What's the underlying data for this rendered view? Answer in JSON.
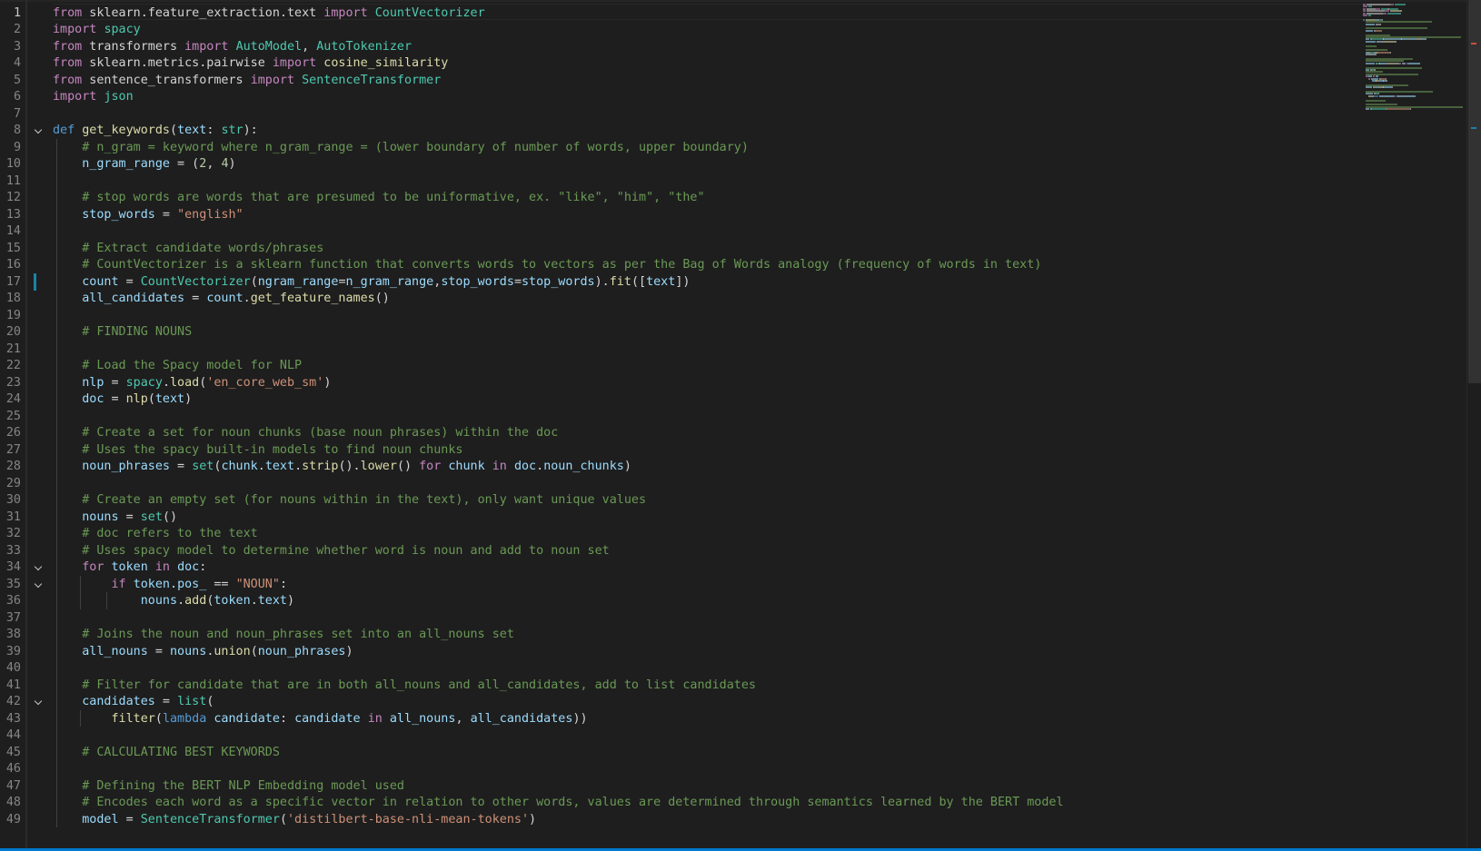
{
  "editor": {
    "language": "python",
    "active_line": 1,
    "theme_colors": {
      "background": "#1e1e1e",
      "keyword": "#569cd6",
      "control_keyword": "#c586c0",
      "comment": "#6a9955",
      "string": "#ce9178",
      "number": "#b5cea8",
      "function": "#dcdcaa",
      "variable": "#9cdcfe",
      "type": "#4ec9b0"
    },
    "fold_icon": "chevron-down-icon",
    "folded_lines": [
      8,
      34,
      35,
      42
    ],
    "modified_lines": [
      17
    ]
  },
  "lines": [
    {
      "n": "1",
      "tokens": [
        [
          "kc",
          "from"
        ],
        [
          "p",
          " sklearn.feature_extraction.text "
        ],
        [
          "kc",
          "import"
        ],
        [
          "p",
          " "
        ],
        [
          "t",
          "CountVectorizer"
        ]
      ]
    },
    {
      "n": "2",
      "tokens": [
        [
          "kc",
          "import"
        ],
        [
          "p",
          " "
        ],
        [
          "t",
          "spacy"
        ]
      ]
    },
    {
      "n": "3",
      "tokens": [
        [
          "kc",
          "from"
        ],
        [
          "p",
          " transformers "
        ],
        [
          "kc",
          "import"
        ],
        [
          "p",
          " "
        ],
        [
          "t",
          "AutoModel"
        ],
        [
          "p",
          ", "
        ],
        [
          "t",
          "AutoTokenizer"
        ]
      ]
    },
    {
      "n": "4",
      "tokens": [
        [
          "kc",
          "from"
        ],
        [
          "p",
          " sklearn.metrics.pairwise "
        ],
        [
          "kc",
          "import"
        ],
        [
          "p",
          " "
        ],
        [
          "f",
          "cosine_similarity"
        ]
      ]
    },
    {
      "n": "5",
      "tokens": [
        [
          "kc",
          "from"
        ],
        [
          "p",
          " sentence_transformers "
        ],
        [
          "kc",
          "import"
        ],
        [
          "p",
          " "
        ],
        [
          "t",
          "SentenceTransformer"
        ]
      ]
    },
    {
      "n": "6",
      "tokens": [
        [
          "kc",
          "import"
        ],
        [
          "p",
          " "
        ],
        [
          "t",
          "json"
        ]
      ]
    },
    {
      "n": "7",
      "tokens": []
    },
    {
      "n": "8",
      "tokens": [
        [
          "k",
          "def"
        ],
        [
          "p",
          " "
        ],
        [
          "f",
          "get_keywords"
        ],
        [
          "p",
          "("
        ],
        [
          "v",
          "text"
        ],
        [
          "p",
          ": "
        ],
        [
          "t",
          "str"
        ],
        [
          "p",
          "):"
        ]
      ]
    },
    {
      "n": "9",
      "tokens": [
        [
          "p",
          "    "
        ],
        [
          "c",
          "# n_gram = keyword where n_gram_range = (lower boundary of number of words, upper boundary)"
        ]
      ]
    },
    {
      "n": "10",
      "tokens": [
        [
          "p",
          "    "
        ],
        [
          "v",
          "n_gram_range"
        ],
        [
          "p",
          " = ("
        ],
        [
          "n",
          "2"
        ],
        [
          "p",
          ", "
        ],
        [
          "n",
          "4"
        ],
        [
          "p",
          ")"
        ]
      ]
    },
    {
      "n": "11",
      "tokens": []
    },
    {
      "n": "12",
      "tokens": [
        [
          "p",
          "    "
        ],
        [
          "c",
          "# stop words are words that are presumed to be uniformative, ex. \"like\", \"him\", \"the\""
        ]
      ]
    },
    {
      "n": "13",
      "tokens": [
        [
          "p",
          "    "
        ],
        [
          "v",
          "stop_words"
        ],
        [
          "p",
          " = "
        ],
        [
          "s",
          "\"english\""
        ]
      ]
    },
    {
      "n": "14",
      "tokens": []
    },
    {
      "n": "15",
      "tokens": [
        [
          "p",
          "    "
        ],
        [
          "c",
          "# Extract candidate words/phrases"
        ]
      ]
    },
    {
      "n": "16",
      "tokens": [
        [
          "p",
          "    "
        ],
        [
          "c",
          "# CountVectorizer is a sklearn function that converts words to vectors as per the Bag of Words analogy (frequency of words in text)"
        ]
      ]
    },
    {
      "n": "17",
      "tokens": [
        [
          "p",
          "    "
        ],
        [
          "v",
          "count"
        ],
        [
          "p",
          " = "
        ],
        [
          "t",
          "CountVectorizer"
        ],
        [
          "p",
          "("
        ],
        [
          "v",
          "ngram_range"
        ],
        [
          "p",
          "="
        ],
        [
          "v",
          "n_gram_range"
        ],
        [
          "p",
          ","
        ],
        [
          "v",
          "stop_words"
        ],
        [
          "p",
          "="
        ],
        [
          "v",
          "stop_words"
        ],
        [
          "p",
          ")."
        ],
        [
          "f",
          "fit"
        ],
        [
          "p",
          "(["
        ],
        [
          "v",
          "text"
        ],
        [
          "p",
          "])"
        ]
      ]
    },
    {
      "n": "18",
      "tokens": [
        [
          "p",
          "    "
        ],
        [
          "v",
          "all_candidates"
        ],
        [
          "p",
          " = "
        ],
        [
          "v",
          "count"
        ],
        [
          "p",
          "."
        ],
        [
          "f",
          "get_feature_names"
        ],
        [
          "p",
          "()"
        ]
      ]
    },
    {
      "n": "19",
      "tokens": []
    },
    {
      "n": "20",
      "tokens": [
        [
          "p",
          "    "
        ],
        [
          "c",
          "# FINDING NOUNS"
        ]
      ]
    },
    {
      "n": "21",
      "tokens": []
    },
    {
      "n": "22",
      "tokens": [
        [
          "p",
          "    "
        ],
        [
          "c",
          "# Load the Spacy model for NLP"
        ]
      ]
    },
    {
      "n": "23",
      "tokens": [
        [
          "p",
          "    "
        ],
        [
          "v",
          "nlp"
        ],
        [
          "p",
          " = "
        ],
        [
          "t",
          "spacy"
        ],
        [
          "p",
          "."
        ],
        [
          "f",
          "load"
        ],
        [
          "p",
          "("
        ],
        [
          "s",
          "'en_core_web_sm'"
        ],
        [
          "p",
          ")"
        ]
      ]
    },
    {
      "n": "24",
      "tokens": [
        [
          "p",
          "    "
        ],
        [
          "v",
          "doc"
        ],
        [
          "p",
          " = "
        ],
        [
          "f",
          "nlp"
        ],
        [
          "p",
          "("
        ],
        [
          "v",
          "text"
        ],
        [
          "p",
          ")"
        ]
      ]
    },
    {
      "n": "25",
      "tokens": []
    },
    {
      "n": "26",
      "tokens": [
        [
          "p",
          "    "
        ],
        [
          "c",
          "# Create a set for noun chunks (base noun phrases) within the doc"
        ]
      ]
    },
    {
      "n": "27",
      "tokens": [
        [
          "p",
          "    "
        ],
        [
          "c",
          "# Uses the spacy built-in models to find noun chunks"
        ]
      ]
    },
    {
      "n": "28",
      "tokens": [
        [
          "p",
          "    "
        ],
        [
          "v",
          "noun_phrases"
        ],
        [
          "p",
          " = "
        ],
        [
          "t",
          "set"
        ],
        [
          "p",
          "("
        ],
        [
          "v",
          "chunk"
        ],
        [
          "p",
          "."
        ],
        [
          "v",
          "text"
        ],
        [
          "p",
          "."
        ],
        [
          "f",
          "strip"
        ],
        [
          "p",
          "()."
        ],
        [
          "f",
          "lower"
        ],
        [
          "p",
          "() "
        ],
        [
          "kc",
          "for"
        ],
        [
          "p",
          " "
        ],
        [
          "v",
          "chunk"
        ],
        [
          "p",
          " "
        ],
        [
          "kc",
          "in"
        ],
        [
          "p",
          " "
        ],
        [
          "v",
          "doc"
        ],
        [
          "p",
          "."
        ],
        [
          "v",
          "noun_chunks"
        ],
        [
          "p",
          ")"
        ]
      ]
    },
    {
      "n": "29",
      "tokens": []
    },
    {
      "n": "30",
      "tokens": [
        [
          "p",
          "    "
        ],
        [
          "c",
          "# Create an empty set (for nouns within in the text), only want unique values"
        ]
      ]
    },
    {
      "n": "31",
      "tokens": [
        [
          "p",
          "    "
        ],
        [
          "v",
          "nouns"
        ],
        [
          "p",
          " = "
        ],
        [
          "t",
          "set"
        ],
        [
          "p",
          "()"
        ]
      ]
    },
    {
      "n": "32",
      "tokens": [
        [
          "p",
          "    "
        ],
        [
          "c",
          "# doc refers to the text"
        ]
      ]
    },
    {
      "n": "33",
      "tokens": [
        [
          "p",
          "    "
        ],
        [
          "c",
          "# Uses spacy model to determine whether word is noun and add to noun set"
        ]
      ]
    },
    {
      "n": "34",
      "tokens": [
        [
          "p",
          "    "
        ],
        [
          "kc",
          "for"
        ],
        [
          "p",
          " "
        ],
        [
          "v",
          "token"
        ],
        [
          "p",
          " "
        ],
        [
          "kc",
          "in"
        ],
        [
          "p",
          " "
        ],
        [
          "v",
          "doc"
        ],
        [
          "p",
          ":"
        ]
      ]
    },
    {
      "n": "35",
      "tokens": [
        [
          "p",
          "        "
        ],
        [
          "kc",
          "if"
        ],
        [
          "p",
          " "
        ],
        [
          "v",
          "token"
        ],
        [
          "p",
          "."
        ],
        [
          "v",
          "pos_"
        ],
        [
          "p",
          " == "
        ],
        [
          "s",
          "\"NOUN\""
        ],
        [
          "p",
          ":"
        ]
      ]
    },
    {
      "n": "36",
      "tokens": [
        [
          "p",
          "            "
        ],
        [
          "v",
          "nouns"
        ],
        [
          "p",
          "."
        ],
        [
          "f",
          "add"
        ],
        [
          "p",
          "("
        ],
        [
          "v",
          "token"
        ],
        [
          "p",
          "."
        ],
        [
          "v",
          "text"
        ],
        [
          "p",
          ")"
        ]
      ]
    },
    {
      "n": "37",
      "tokens": []
    },
    {
      "n": "38",
      "tokens": [
        [
          "p",
          "    "
        ],
        [
          "c",
          "# Joins the noun and noun_phrases set into an all_nouns set"
        ]
      ]
    },
    {
      "n": "39",
      "tokens": [
        [
          "p",
          "    "
        ],
        [
          "v",
          "all_nouns"
        ],
        [
          "p",
          " = "
        ],
        [
          "v",
          "nouns"
        ],
        [
          "p",
          "."
        ],
        [
          "f",
          "union"
        ],
        [
          "p",
          "("
        ],
        [
          "v",
          "noun_phrases"
        ],
        [
          "p",
          ")"
        ]
      ]
    },
    {
      "n": "40",
      "tokens": []
    },
    {
      "n": "41",
      "tokens": [
        [
          "p",
          "    "
        ],
        [
          "c",
          "# Filter for candidate that are in both all_nouns and all_candidates, add to list candidates"
        ]
      ]
    },
    {
      "n": "42",
      "tokens": [
        [
          "p",
          "    "
        ],
        [
          "v",
          "candidates"
        ],
        [
          "p",
          " = "
        ],
        [
          "t",
          "list"
        ],
        [
          "p",
          "("
        ]
      ]
    },
    {
      "n": "43",
      "tokens": [
        [
          "p",
          "        "
        ],
        [
          "f",
          "filter"
        ],
        [
          "p",
          "("
        ],
        [
          "k",
          "lambda"
        ],
        [
          "p",
          " "
        ],
        [
          "v",
          "candidate"
        ],
        [
          "p",
          ": "
        ],
        [
          "v",
          "candidate"
        ],
        [
          "p",
          " "
        ],
        [
          "kc",
          "in"
        ],
        [
          "p",
          " "
        ],
        [
          "v",
          "all_nouns"
        ],
        [
          "p",
          ", "
        ],
        [
          "v",
          "all_candidates"
        ],
        [
          "p",
          "))"
        ]
      ]
    },
    {
      "n": "44",
      "tokens": []
    },
    {
      "n": "45",
      "tokens": [
        [
          "p",
          "    "
        ],
        [
          "c",
          "# CALCULATING BEST KEYWORDS"
        ]
      ]
    },
    {
      "n": "46",
      "tokens": []
    },
    {
      "n": "47",
      "tokens": [
        [
          "p",
          "    "
        ],
        [
          "c",
          "# Defining the BERT NLP Embedding model used"
        ]
      ]
    },
    {
      "n": "48",
      "tokens": [
        [
          "p",
          "    "
        ],
        [
          "c",
          "# Encodes each word as a specific vector in relation to other words, values are determined through semantics learned by the BERT model"
        ]
      ]
    },
    {
      "n": "49",
      "tokens": [
        [
          "p",
          "    "
        ],
        [
          "v",
          "model"
        ],
        [
          "p",
          " = "
        ],
        [
          "t",
          "SentenceTransformer"
        ],
        [
          "p",
          "("
        ],
        [
          "s",
          "'distilbert-base-nli-mean-tokens'"
        ],
        [
          "p",
          ")"
        ]
      ]
    }
  ]
}
